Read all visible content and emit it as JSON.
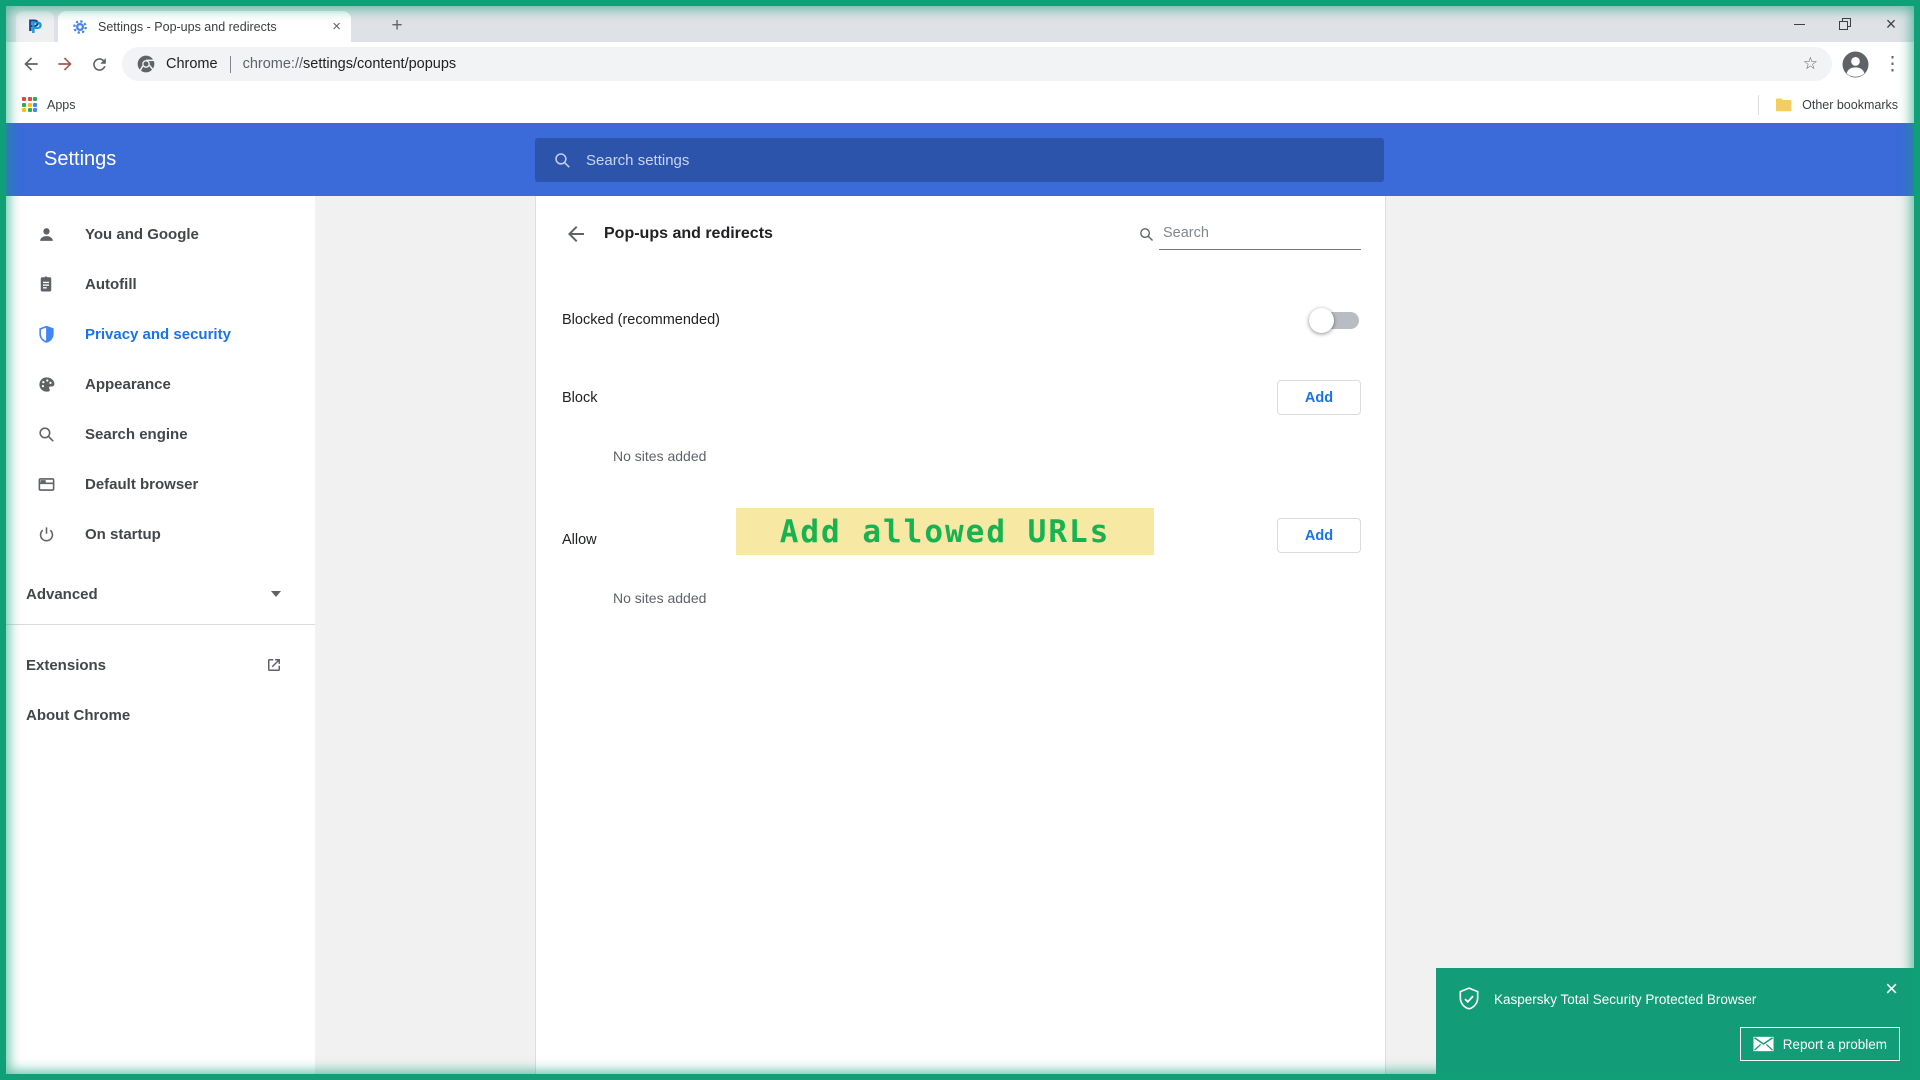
{
  "tab_strip": {
    "active_tab_title": "Settings - Pop-ups and redirects",
    "new_tab_glyph": "+",
    "tab_close_glyph": "×"
  },
  "window_controls": {
    "close_glyph": "×"
  },
  "toolbar": {
    "site_label": "Chrome",
    "url_scheme": "chrome://",
    "url_path": "settings/content/popups",
    "star_glyph": "☆",
    "menu_glyph": "⋮"
  },
  "bookmarks_bar": {
    "apps_label": "Apps",
    "other_bookmarks_label": "Other bookmarks"
  },
  "settings_header": {
    "title": "Settings",
    "search_placeholder": "Search settings"
  },
  "sidebar": {
    "items": [
      {
        "label": "You and Google"
      },
      {
        "label": "Autofill"
      },
      {
        "label": "Privacy and security"
      },
      {
        "label": "Appearance"
      },
      {
        "label": "Search engine"
      },
      {
        "label": "Default browser"
      },
      {
        "label": "On startup"
      }
    ],
    "advanced_label": "Advanced",
    "extensions_label": "Extensions",
    "about_label": "About Chrome"
  },
  "content": {
    "title": "Pop-ups and redirects",
    "search_placeholder": "Search",
    "blocked_toggle": {
      "label": "Blocked (recommended)",
      "enabled": false
    },
    "block": {
      "label": "Block",
      "add_button": "Add",
      "empty": "No sites added"
    },
    "allow": {
      "label": "Allow",
      "add_button": "Add",
      "empty": "No sites added"
    }
  },
  "annotation": {
    "text": "Add allowed URLs"
  },
  "notification": {
    "title": "Kaspersky Total Security Protected Browser",
    "report_button": "Report a problem",
    "close_glyph": "×"
  },
  "colors": {
    "header_blue": "#3A6BD9",
    "header_search_blue": "#2D54AB",
    "accent_blue": "#1A73E8",
    "frame_green": "#0FA077",
    "kaspersky_green": "#139C78",
    "annotation_bg": "#F7E8A3",
    "annotation_text": "#17B251"
  }
}
